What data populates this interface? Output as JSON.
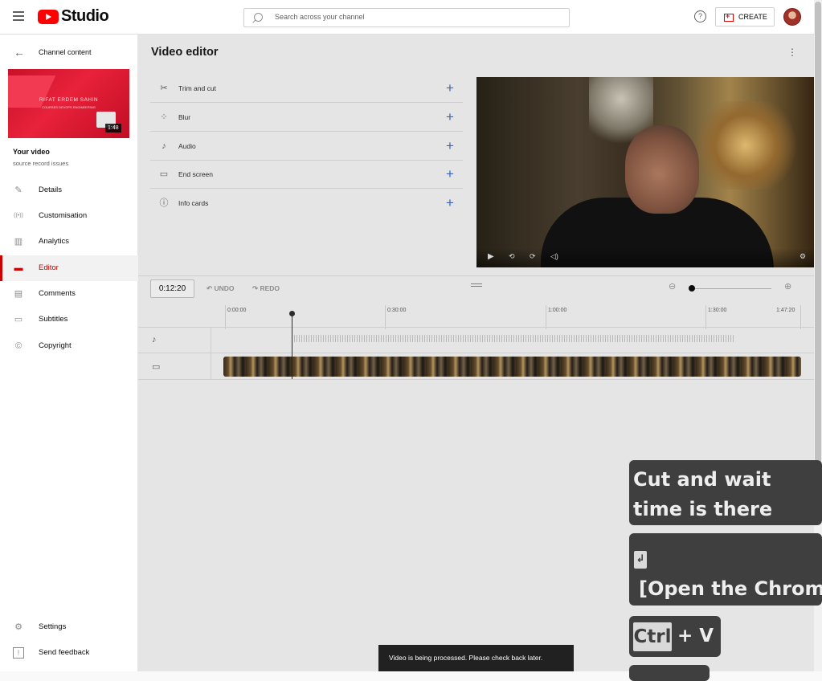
{
  "app": {
    "title": "Studio"
  },
  "search": {
    "placeholder": "Search across your channel"
  },
  "header": {
    "help": "?",
    "create_label": "CREATE"
  },
  "sidebar": {
    "back_label": "Channel content",
    "thumbnail": {
      "name": "RIFAT ERDEM SAHIN",
      "subtitle": "COURSES DEVOPS ENGINEERING",
      "duration": "1:48"
    },
    "your_video": "Your video",
    "video_title": "source record issues",
    "items": [
      {
        "label": "Details",
        "icon": "pencil-icon",
        "glyph": "✎"
      },
      {
        "label": "Customisation",
        "icon": "broadcast-icon",
        "glyph": "((•))"
      },
      {
        "label": "Analytics",
        "icon": "analytics-icon",
        "glyph": "▥"
      },
      {
        "label": "Editor",
        "icon": "clapperboard-icon",
        "glyph": "▬"
      },
      {
        "label": "Comments",
        "icon": "comments-icon",
        "glyph": "▤"
      },
      {
        "label": "Subtitles",
        "icon": "subtitles-icon",
        "glyph": "▭"
      },
      {
        "label": "Copyright",
        "icon": "copyright-icon",
        "glyph": "©"
      }
    ],
    "bottom": [
      {
        "label": "Settings",
        "icon": "gear-icon",
        "glyph": "⚙"
      },
      {
        "label": "Send feedback",
        "icon": "feedback-icon",
        "glyph": "!"
      }
    ],
    "active_color": "#cc0000"
  },
  "editor": {
    "title": "Video editor",
    "more": "⋮",
    "tools": [
      {
        "label": "Trim and cut",
        "icon": "scissors-icon",
        "glyph": "✂"
      },
      {
        "label": "Blur",
        "icon": "blur-icon",
        "glyph": "⁘"
      },
      {
        "label": "Audio",
        "icon": "music-note-icon",
        "glyph": "♪"
      },
      {
        "label": "End screen",
        "icon": "end-screen-icon",
        "glyph": "▭"
      },
      {
        "label": "Info cards",
        "icon": "info-icon",
        "glyph": "ⓘ"
      }
    ],
    "add_glyph": "+"
  },
  "timeline": {
    "current_time": "0:12:20",
    "undo": "UNDO",
    "redo": "REDO",
    "ruler": [
      "0:00:00",
      "0:30:00",
      "1:00:00",
      "1:30:00",
      "1:47:20"
    ]
  },
  "snackbar": {
    "message": "Video is being processed. Please check back later."
  },
  "overlays": {
    "caption": "Cut and wait time is there",
    "enter_key": "↲",
    "open_text": "[Open the Chrome",
    "ctrl_key": "Ctrl",
    "plus_v": "+ V"
  }
}
